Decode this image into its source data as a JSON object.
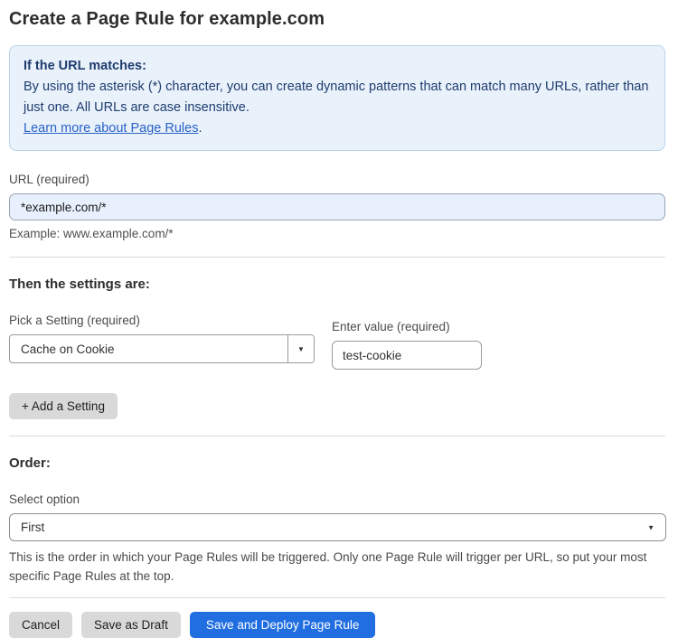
{
  "page": {
    "title": "Create a Page Rule for example.com"
  },
  "info_box": {
    "heading": "If the URL matches:",
    "body": "By using the asterisk (*) character, you can create dynamic patterns that can match many URLs, rather than just one. All URLs are case insensitive.",
    "link_label": "Learn more about Page Rules",
    "link_suffix": "."
  },
  "url_field": {
    "label": "URL (required)",
    "value": "*example.com/*",
    "helper": "Example: www.example.com/*"
  },
  "settings_section": {
    "heading": "Then the settings are:",
    "setting_label": "Pick a Setting (required)",
    "setting_value": "Cache on Cookie",
    "value_label": "Enter value (required)",
    "value_value": "test-cookie",
    "add_button_label": "+ Add a Setting"
  },
  "order_section": {
    "heading": "Order:",
    "select_label": "Select option",
    "select_value": "First",
    "helper": "This is the order in which your Page Rules will be triggered. Only one Page Rule will trigger per URL, so put your most specific Page Rules at the top."
  },
  "footer": {
    "cancel_label": "Cancel",
    "save_draft_label": "Save as Draft",
    "save_deploy_label": "Save and Deploy Page Rule"
  },
  "icons": {
    "dropdown_arrow": "▼",
    "select_chevron": "▼"
  },
  "colors": {
    "primary_blue": "#206ee0",
    "info_box_bg": "#e9f1fb",
    "info_box_border": "#b9d3ee",
    "info_box_text": "#1e3c6e",
    "link_blue": "#2962c6",
    "url_input_bg": "#e8f0fe",
    "gray_button_bg": "#d9d9d9"
  }
}
